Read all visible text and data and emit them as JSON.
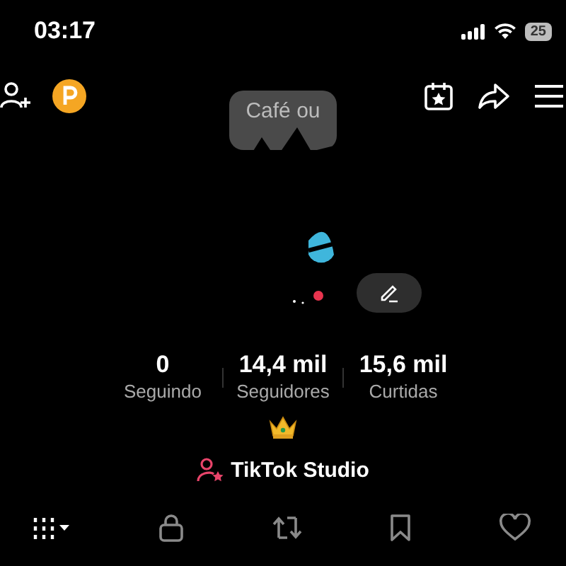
{
  "status_bar": {
    "time": "03:17",
    "battery": "25"
  },
  "note_bubble": {
    "text": "Café ou"
  },
  "stats": [
    {
      "value": "0",
      "label": "Seguindo"
    },
    {
      "value": "14,4 mil",
      "label": "Seguidores"
    },
    {
      "value": "15,6 mil",
      "label": "Curtidas"
    }
  ],
  "studio_link": {
    "label": "TikTok Studio"
  },
  "tabs": [
    {
      "kind": "grid",
      "selected": true
    },
    {
      "kind": "lock",
      "selected": false
    },
    {
      "kind": "repost",
      "selected": false
    },
    {
      "kind": "bookmark",
      "selected": false
    },
    {
      "kind": "heart",
      "selected": false
    }
  ]
}
